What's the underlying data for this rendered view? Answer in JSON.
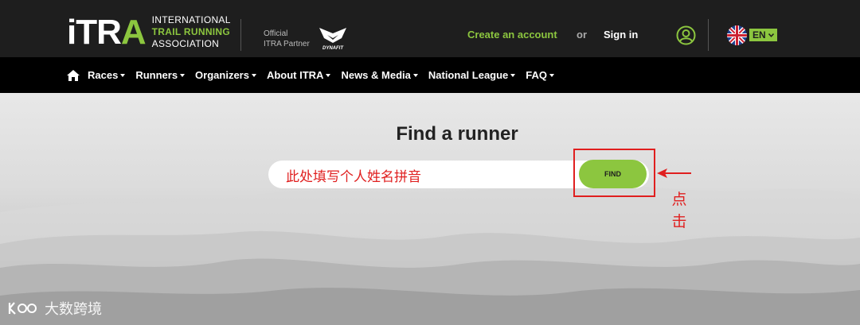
{
  "header": {
    "logo_main": "iTR",
    "logo_accent": "A",
    "logo_tag_line1": "INTERNATIONAL",
    "logo_tag_line2": "TRAIL RUNNING",
    "logo_tag_line3": "ASSOCIATION",
    "partner_line1": "Official",
    "partner_line2": "ITRA Partner",
    "partner_logo_text": "DYNAFIT",
    "create_account": "Create an account",
    "or": "or",
    "sign_in": "Sign in",
    "language": "EN"
  },
  "nav": {
    "items": [
      {
        "label": "Races"
      },
      {
        "label": "Runners"
      },
      {
        "label": "Organizers"
      },
      {
        "label": "About ITRA"
      },
      {
        "label": "News & Media"
      },
      {
        "label": "National League"
      },
      {
        "label": "FAQ"
      }
    ]
  },
  "main": {
    "title": "Find a runner",
    "search_value": "此处填写个人姓名拼音",
    "find_label": "FIND"
  },
  "annotation": {
    "click_note": "点击"
  },
  "watermark": {
    "text": "大数跨境"
  },
  "colors": {
    "brand_green": "#8cc63f",
    "header_bg": "#1e1e1e",
    "nav_bg": "#000000",
    "annotation_red": "#e01f1f"
  }
}
